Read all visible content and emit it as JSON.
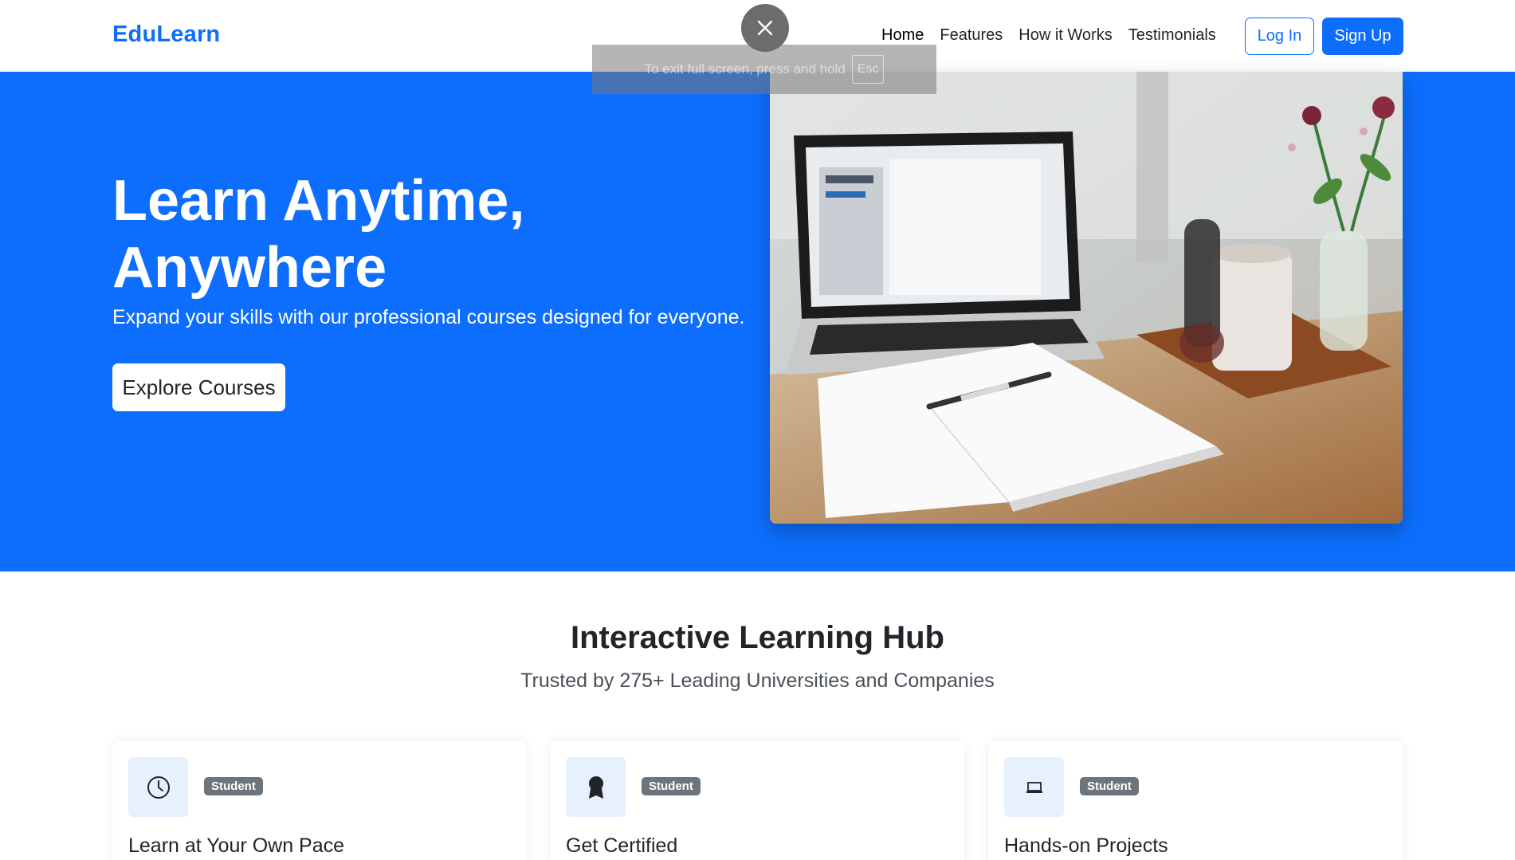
{
  "navbar": {
    "brand": "EduLearn",
    "links": [
      {
        "label": "Home",
        "active": true
      },
      {
        "label": "Features"
      },
      {
        "label": "How it Works"
      },
      {
        "label": "Testimonials"
      }
    ],
    "login_label": "Log In",
    "signup_label": "Sign Up"
  },
  "fullscreen_notice": {
    "text": "To exit full screen, press and hold",
    "key": "Esc",
    "close_icon": "close-icon"
  },
  "hero": {
    "title": "Learn Anytime, Anywhere",
    "subtitle": "Expand your skills with our professional courses designed for everyone.",
    "cta_label": "Explore Courses",
    "image": "laptop-notebook-coffee-photo"
  },
  "features": {
    "title": "Interactive Learning Hub",
    "subtitle": "Trusted by 275+ Leading Universities and Companies",
    "cards": [
      {
        "icon": "clock-icon",
        "badge": "Student",
        "title": "Learn at Your Own Pace"
      },
      {
        "icon": "certificate-icon",
        "badge": "Student",
        "title": "Get Certified"
      },
      {
        "icon": "laptop-icon",
        "badge": "Student",
        "title": "Hands-on Projects"
      }
    ]
  },
  "colors": {
    "primary": "#0d6efd",
    "badge": "#6c757d",
    "icon_bg": "#e7f0fd"
  }
}
